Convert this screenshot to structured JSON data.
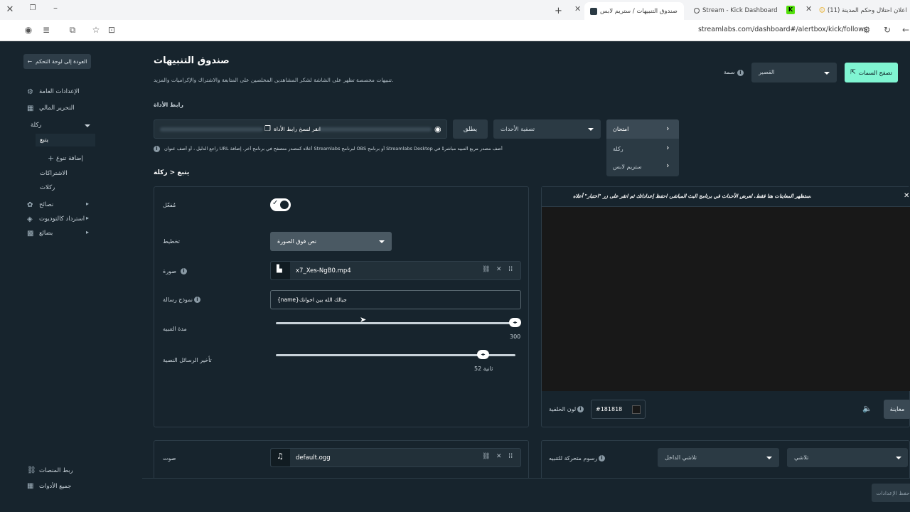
{
  "browser": {
    "tabs": [
      {
        "title": "(11) اعلان احتلال وحكم المدينة"
      },
      {
        "title": "Stream - Kick Dashboard"
      },
      {
        "title": "صندوق التنبيهات / ستريم لابس"
      }
    ],
    "url": "streamlabs.com/dashboard#/alertbox/kick/follows"
  },
  "sidebar": {
    "back_label": "العودة إلى لوحة التحكم",
    "items": [
      {
        "label": "الإعدادات العامة"
      },
      {
        "label": "التحرير المالي"
      },
      {
        "label": "ركلة"
      },
      {
        "label": "يتبع"
      },
      {
        "label": "إضافة تنوع"
      },
      {
        "label": "الاشتراكات"
      },
      {
        "label": "ركلات"
      },
      {
        "label": "نصائح"
      },
      {
        "label": "استرداد كالتوديوت"
      },
      {
        "label": "بضائع"
      }
    ],
    "bottom": [
      {
        "label": "ربط المنصات"
      },
      {
        "label": "جميع الأدوات"
      }
    ]
  },
  "header": {
    "title": "صندوق التنبيهات",
    "subtitle": "تنبيهات مخصصة تظهر على الشاشة لشكر المشاهدين المخلصين على المتابعة والاشتراك والإكراميات والمزيد.",
    "theme_label": "سمة",
    "theme_value": "القصير",
    "browse_themes": "تصفح السمات"
  },
  "widget_url": {
    "label": "رابط الأداة",
    "copy_label": "انقر لنسخ رابط الأداة",
    "launch_label": "يطلق",
    "filter_label": "تصفية الأحداث",
    "help_text": "راجع الدليل ، أو أضف عنوان URL أعلاه كمصدر متصفح في برنامج آخر. إضافة Streamlabs لبرنامج OBS أو برنامج Streamlabs Desktop أضف مصدر مربع التنبيه مباشرةً في"
  },
  "test_menu": {
    "title": "امتحان",
    "items": [
      {
        "label": "ركلة"
      },
      {
        "label": "ستريم لابس"
      }
    ]
  },
  "breadcrumb": "يتبع < ركلة",
  "settings": {
    "enabled_label": "مُفعّل",
    "layout_label": "تخطيط",
    "layout_value": "نص فوق الصورة",
    "image_label": "صورة",
    "image_file": "x7_Xes-NgB0.mp4",
    "message_label": "نموذج رسالة",
    "message_value": "{name}جبالك الله بين اخوانك",
    "duration_label": "مدة التنبيه",
    "duration_value": "300",
    "duration_fraction": 1.0,
    "delay_label": "تأخير الرسائل النصية",
    "delay_value": "52 ثانية",
    "delay_fraction": 0.86,
    "sound_label": "صوت",
    "sound_file": "default.ogg"
  },
  "preview": {
    "notice": "ستظهر المعاينات هنا فقط. لعرض الأحداث في برنامج البث المباشر، احفظ إعداداتك ثم انقر على زر \"اختبار\" أعلاه.",
    "bg_label": "لون الخلفية",
    "bg_value": "#181818",
    "preview_button": "معاينة"
  },
  "animation": {
    "label": "رسوم متحركة للتنبيه",
    "in_value": "تلاشي الداخل",
    "out_value": "تلاشي"
  },
  "save_label": "حفظ الإعدادات"
}
